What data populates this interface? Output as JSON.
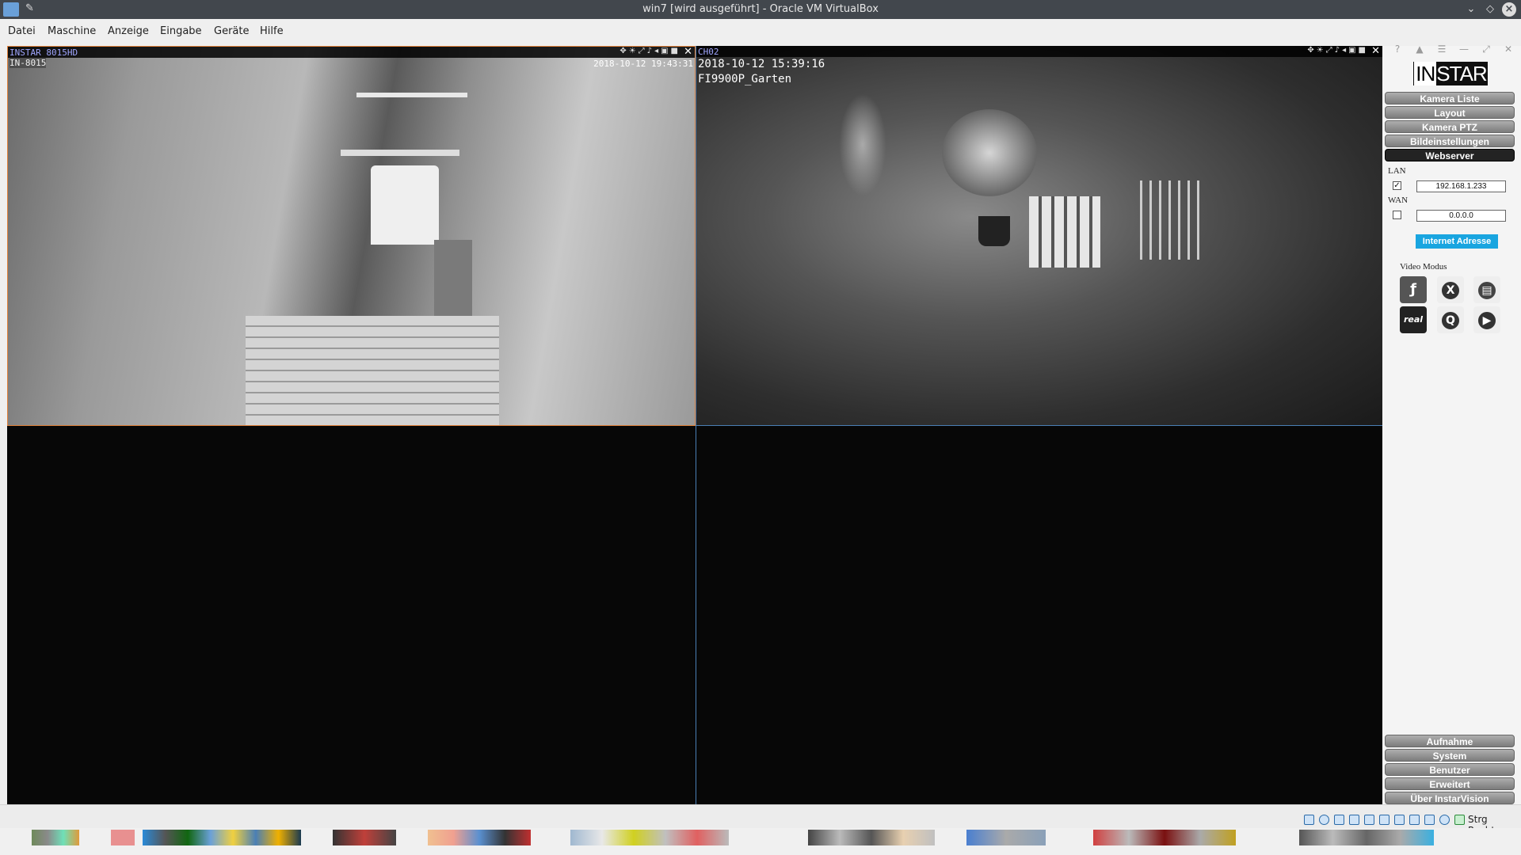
{
  "window": {
    "title": "win7 [wird ausgeführt] - Oracle VM VirtualBox",
    "pin_icon": "pin-icon",
    "controls": [
      "minimize-icon",
      "restore-icon",
      "close-icon"
    ]
  },
  "menu": {
    "items": [
      "Datei",
      "Maschine",
      "Anzeige",
      "Eingabe",
      "Geräte",
      "Hilfe"
    ]
  },
  "cameras": [
    {
      "name": "INSTAR 8015HD",
      "sub": "IN-8015",
      "timestamp": "2018-10-12 19:43:31",
      "border_color": "#e0813a"
    },
    {
      "name": "CH02",
      "timestamp": "2018-10-12 15:39:16",
      "label": "FI9900P_Garten",
      "border_color": "#4a7fb5"
    }
  ],
  "sidebar": {
    "logo": "INSTAR",
    "top_nav": [
      "Kamera Liste",
      "Layout",
      "Kamera PTZ",
      "Bildeinstellungen",
      "Webserver"
    ],
    "active_nav": "Webserver",
    "webserver": {
      "lan_label": "LAN",
      "lan_checked": true,
      "lan_ip": "192.168.1.233",
      "wan_label": "WAN",
      "wan_checked": false,
      "wan_ip": "0.0.0.0",
      "internet_button": "Internet Adresse",
      "video_mode_label": "Video Modus",
      "video_modes": [
        "flash-icon",
        "activex-icon",
        "mjpeg-icon",
        "real-icon",
        "quicktime-icon",
        "play-icon"
      ],
      "real_text": "real"
    },
    "bottom_nav": [
      "Aufnahme",
      "System",
      "Benutzer",
      "Erweitert",
      "Über InstarVision"
    ],
    "accent": "#19a5e0"
  },
  "statusbar": {
    "host_key": "Strg Rechts"
  }
}
